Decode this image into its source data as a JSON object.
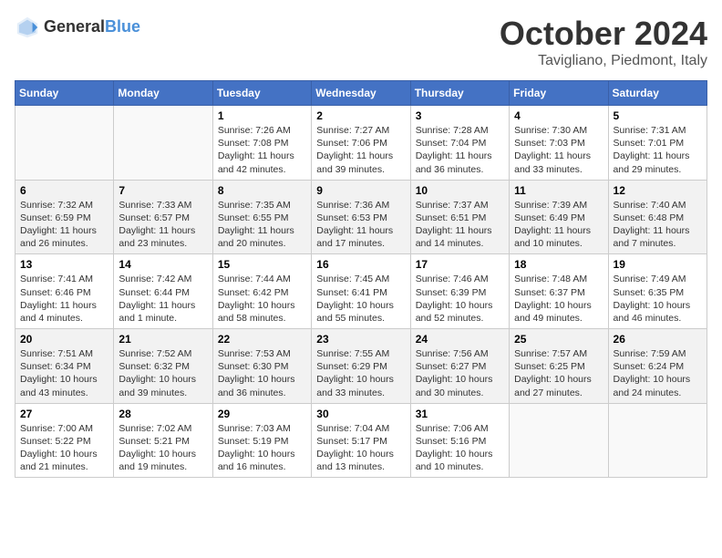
{
  "header": {
    "logo_general": "General",
    "logo_blue": "Blue",
    "month": "October 2024",
    "location": "Tavigliano, Piedmont, Italy"
  },
  "weekdays": [
    "Sunday",
    "Monday",
    "Tuesday",
    "Wednesday",
    "Thursday",
    "Friday",
    "Saturday"
  ],
  "weeks": [
    [
      {
        "day": "",
        "sunrise": "",
        "sunset": "",
        "daylight": ""
      },
      {
        "day": "",
        "sunrise": "",
        "sunset": "",
        "daylight": ""
      },
      {
        "day": "1",
        "sunrise": "Sunrise: 7:26 AM",
        "sunset": "Sunset: 7:08 PM",
        "daylight": "Daylight: 11 hours and 42 minutes."
      },
      {
        "day": "2",
        "sunrise": "Sunrise: 7:27 AM",
        "sunset": "Sunset: 7:06 PM",
        "daylight": "Daylight: 11 hours and 39 minutes."
      },
      {
        "day": "3",
        "sunrise": "Sunrise: 7:28 AM",
        "sunset": "Sunset: 7:04 PM",
        "daylight": "Daylight: 11 hours and 36 minutes."
      },
      {
        "day": "4",
        "sunrise": "Sunrise: 7:30 AM",
        "sunset": "Sunset: 7:03 PM",
        "daylight": "Daylight: 11 hours and 33 minutes."
      },
      {
        "day": "5",
        "sunrise": "Sunrise: 7:31 AM",
        "sunset": "Sunset: 7:01 PM",
        "daylight": "Daylight: 11 hours and 29 minutes."
      }
    ],
    [
      {
        "day": "6",
        "sunrise": "Sunrise: 7:32 AM",
        "sunset": "Sunset: 6:59 PM",
        "daylight": "Daylight: 11 hours and 26 minutes."
      },
      {
        "day": "7",
        "sunrise": "Sunrise: 7:33 AM",
        "sunset": "Sunset: 6:57 PM",
        "daylight": "Daylight: 11 hours and 23 minutes."
      },
      {
        "day": "8",
        "sunrise": "Sunrise: 7:35 AM",
        "sunset": "Sunset: 6:55 PM",
        "daylight": "Daylight: 11 hours and 20 minutes."
      },
      {
        "day": "9",
        "sunrise": "Sunrise: 7:36 AM",
        "sunset": "Sunset: 6:53 PM",
        "daylight": "Daylight: 11 hours and 17 minutes."
      },
      {
        "day": "10",
        "sunrise": "Sunrise: 7:37 AM",
        "sunset": "Sunset: 6:51 PM",
        "daylight": "Daylight: 11 hours and 14 minutes."
      },
      {
        "day": "11",
        "sunrise": "Sunrise: 7:39 AM",
        "sunset": "Sunset: 6:49 PM",
        "daylight": "Daylight: 11 hours and 10 minutes."
      },
      {
        "day": "12",
        "sunrise": "Sunrise: 7:40 AM",
        "sunset": "Sunset: 6:48 PM",
        "daylight": "Daylight: 11 hours and 7 minutes."
      }
    ],
    [
      {
        "day": "13",
        "sunrise": "Sunrise: 7:41 AM",
        "sunset": "Sunset: 6:46 PM",
        "daylight": "Daylight: 11 hours and 4 minutes."
      },
      {
        "day": "14",
        "sunrise": "Sunrise: 7:42 AM",
        "sunset": "Sunset: 6:44 PM",
        "daylight": "Daylight: 11 hours and 1 minute."
      },
      {
        "day": "15",
        "sunrise": "Sunrise: 7:44 AM",
        "sunset": "Sunset: 6:42 PM",
        "daylight": "Daylight: 10 hours and 58 minutes."
      },
      {
        "day": "16",
        "sunrise": "Sunrise: 7:45 AM",
        "sunset": "Sunset: 6:41 PM",
        "daylight": "Daylight: 10 hours and 55 minutes."
      },
      {
        "day": "17",
        "sunrise": "Sunrise: 7:46 AM",
        "sunset": "Sunset: 6:39 PM",
        "daylight": "Daylight: 10 hours and 52 minutes."
      },
      {
        "day": "18",
        "sunrise": "Sunrise: 7:48 AM",
        "sunset": "Sunset: 6:37 PM",
        "daylight": "Daylight: 10 hours and 49 minutes."
      },
      {
        "day": "19",
        "sunrise": "Sunrise: 7:49 AM",
        "sunset": "Sunset: 6:35 PM",
        "daylight": "Daylight: 10 hours and 46 minutes."
      }
    ],
    [
      {
        "day": "20",
        "sunrise": "Sunrise: 7:51 AM",
        "sunset": "Sunset: 6:34 PM",
        "daylight": "Daylight: 10 hours and 43 minutes."
      },
      {
        "day": "21",
        "sunrise": "Sunrise: 7:52 AM",
        "sunset": "Sunset: 6:32 PM",
        "daylight": "Daylight: 10 hours and 39 minutes."
      },
      {
        "day": "22",
        "sunrise": "Sunrise: 7:53 AM",
        "sunset": "Sunset: 6:30 PM",
        "daylight": "Daylight: 10 hours and 36 minutes."
      },
      {
        "day": "23",
        "sunrise": "Sunrise: 7:55 AM",
        "sunset": "Sunset: 6:29 PM",
        "daylight": "Daylight: 10 hours and 33 minutes."
      },
      {
        "day": "24",
        "sunrise": "Sunrise: 7:56 AM",
        "sunset": "Sunset: 6:27 PM",
        "daylight": "Daylight: 10 hours and 30 minutes."
      },
      {
        "day": "25",
        "sunrise": "Sunrise: 7:57 AM",
        "sunset": "Sunset: 6:25 PM",
        "daylight": "Daylight: 10 hours and 27 minutes."
      },
      {
        "day": "26",
        "sunrise": "Sunrise: 7:59 AM",
        "sunset": "Sunset: 6:24 PM",
        "daylight": "Daylight: 10 hours and 24 minutes."
      }
    ],
    [
      {
        "day": "27",
        "sunrise": "Sunrise: 7:00 AM",
        "sunset": "Sunset: 5:22 PM",
        "daylight": "Daylight: 10 hours and 21 minutes."
      },
      {
        "day": "28",
        "sunrise": "Sunrise: 7:02 AM",
        "sunset": "Sunset: 5:21 PM",
        "daylight": "Daylight: 10 hours and 19 minutes."
      },
      {
        "day": "29",
        "sunrise": "Sunrise: 7:03 AM",
        "sunset": "Sunset: 5:19 PM",
        "daylight": "Daylight: 10 hours and 16 minutes."
      },
      {
        "day": "30",
        "sunrise": "Sunrise: 7:04 AM",
        "sunset": "Sunset: 5:17 PM",
        "daylight": "Daylight: 10 hours and 13 minutes."
      },
      {
        "day": "31",
        "sunrise": "Sunrise: 7:06 AM",
        "sunset": "Sunset: 5:16 PM",
        "daylight": "Daylight: 10 hours and 10 minutes."
      },
      {
        "day": "",
        "sunrise": "",
        "sunset": "",
        "daylight": ""
      },
      {
        "day": "",
        "sunrise": "",
        "sunset": "",
        "daylight": ""
      }
    ]
  ]
}
